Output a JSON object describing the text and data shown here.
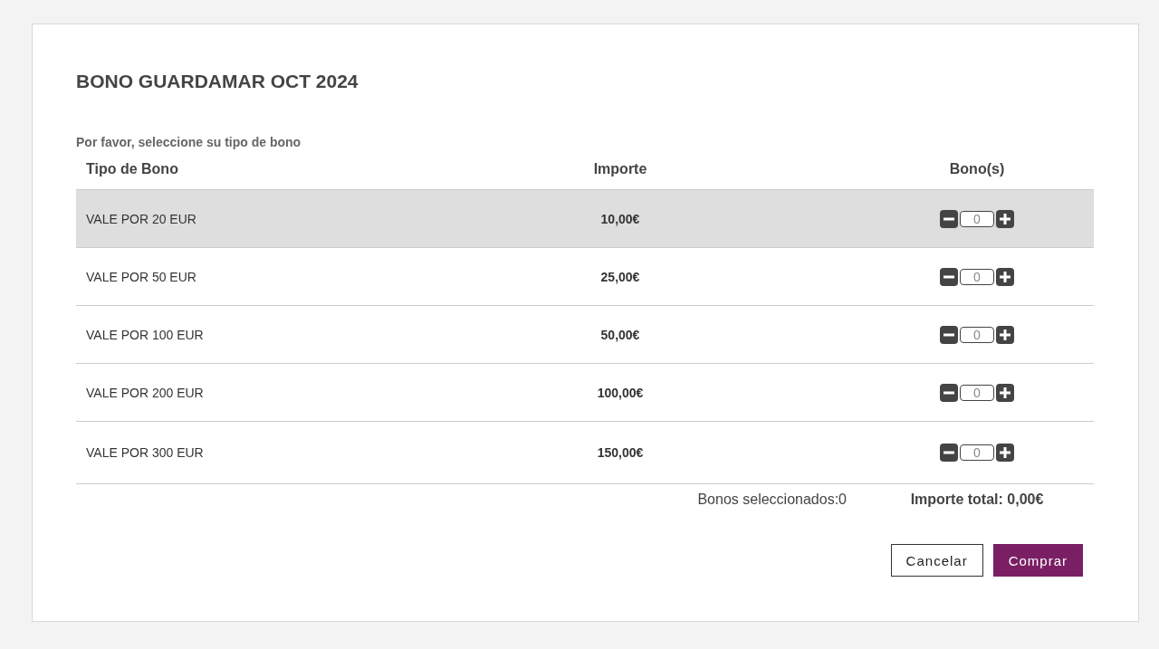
{
  "title": "BONO GUARDAMAR OCT 2024",
  "instruction": "Por favor, seleccione su tipo de bono",
  "table": {
    "columns": [
      "Tipo de Bono",
      "Importe",
      "Bono(s)"
    ],
    "rows": [
      {
        "type": "VALE POR 20 EUR",
        "amount": "10,00€",
        "quantity": "0",
        "highlighted": true
      },
      {
        "type": "VALE POR 50 EUR",
        "amount": "25,00€",
        "quantity": "0",
        "highlighted": false
      },
      {
        "type": "VALE POR 100 EUR",
        "amount": "50,00€",
        "quantity": "0",
        "highlighted": false
      },
      {
        "type": "VALE POR 200 EUR",
        "amount": "100,00€",
        "quantity": "0",
        "highlighted": false
      },
      {
        "type": "VALE POR 300 EUR",
        "amount": "150,00€",
        "quantity": "0",
        "highlighted": false
      }
    ]
  },
  "summary": {
    "selected_count": "Bonos seleccionados:0",
    "total": "Importe total: 0,00€"
  },
  "buttons": [
    {
      "label": "Cancelar",
      "kind": "secondary"
    },
    {
      "label": "Comprar",
      "kind": "primary"
    }
  ]
}
